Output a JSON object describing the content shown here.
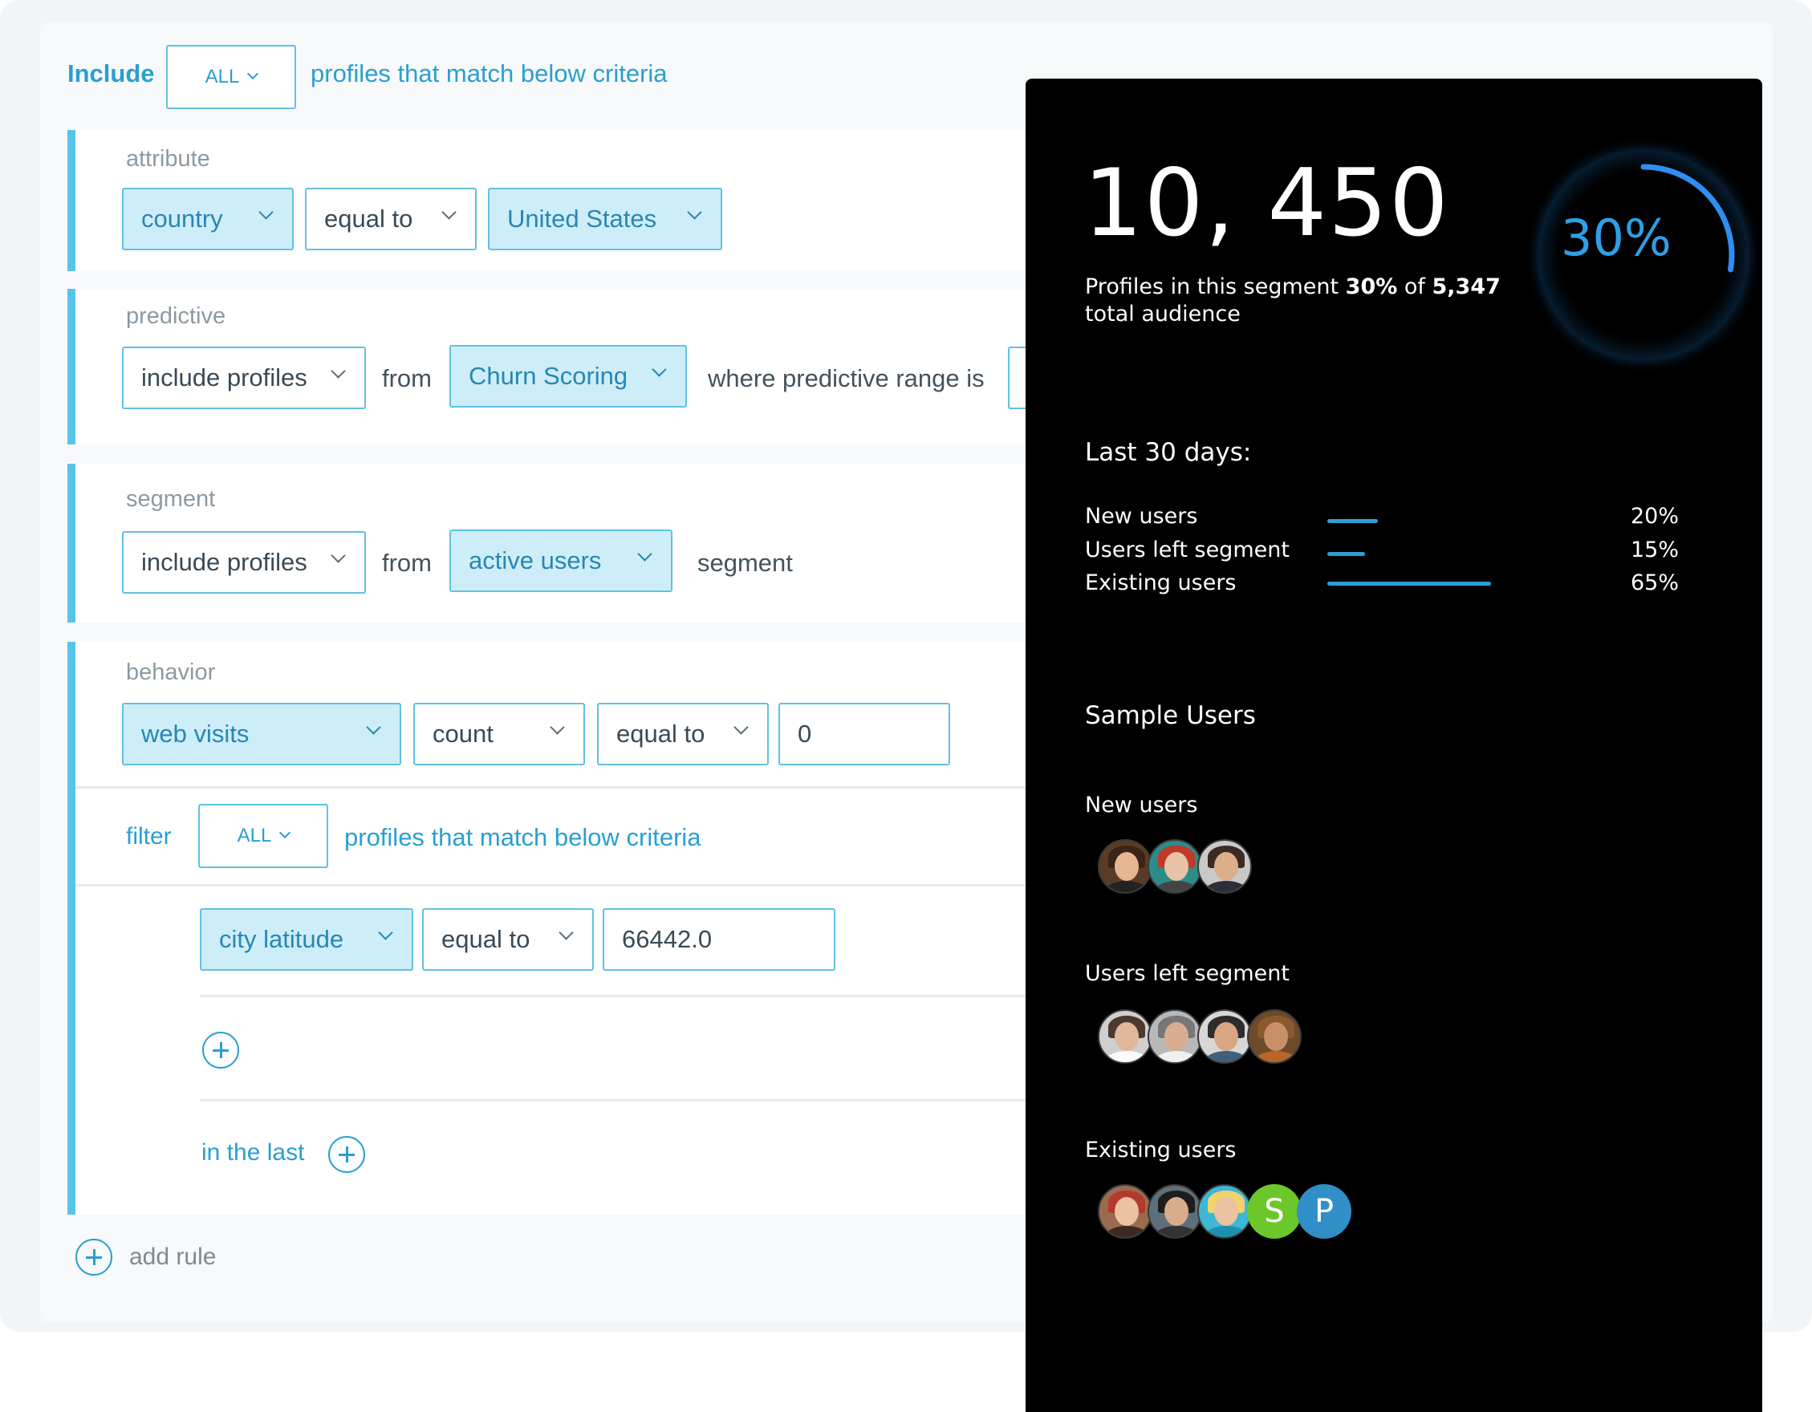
{
  "header": {
    "include_label": "Include",
    "match_select": "ALL",
    "match_text": "profiles that match below criteria"
  },
  "attribute": {
    "label": "attribute",
    "field": "country",
    "operator": "equal to",
    "value": "United States"
  },
  "predictive": {
    "label": "predictive",
    "action": "include profiles",
    "from_text": "from",
    "model": "Churn Scoring",
    "range_text": "where predictive range is"
  },
  "segment": {
    "label": "segment",
    "action": "include profiles",
    "from_text": "from",
    "segment": "active users",
    "suffix": "segment"
  },
  "behavior": {
    "label": "behavior",
    "event": "web visits",
    "aggregate": "count",
    "operator": "equal to",
    "value": "0",
    "filter": {
      "label": "filter",
      "match_select": "ALL",
      "match_text": "profiles that match below criteria",
      "field": "city latitude",
      "operator": "equal to",
      "value": "66442.0"
    },
    "in_the_last": "in the last"
  },
  "add_rule": "add rule",
  "summary": {
    "count": "10, 450",
    "percent": "30%",
    "percent_value": 0.3,
    "line1_pre": "Profiles in this segment ",
    "line1_pct": "30%",
    "line1_mid": " of ",
    "line1_total": "5,347",
    "line2": "total audience",
    "last30_title": "Last 30 days:",
    "stats": [
      {
        "label": "New users",
        "value": "20%",
        "fraction": 0.2
      },
      {
        "label": "Users left segment",
        "value": "15%",
        "fraction": 0.15
      },
      {
        "label": "Existing users",
        "value": "65%",
        "fraction": 0.65
      }
    ],
    "sample_title": "Sample Users",
    "groups": {
      "new": "New users",
      "left": "Users left segment",
      "existing": "Existing users"
    },
    "letters": {
      "s": "S",
      "p": "P"
    }
  },
  "colors": {
    "accent": "#2a9fd0",
    "selected_fill": "#cdeef8",
    "panel_bg": "#000000",
    "ring": "#2f8ff0",
    "avatar_green": "#6cc72b",
    "avatar_blue": "#2f8fc6"
  }
}
